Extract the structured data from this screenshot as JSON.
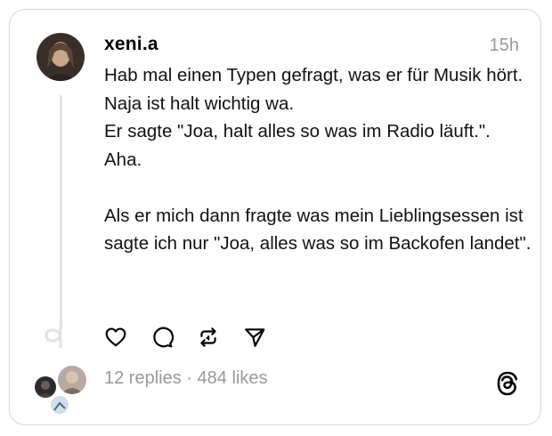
{
  "post": {
    "username": "xeni.a",
    "time": "15h",
    "paragraphs": [
      "Hab mal einen Typen gefragt, was er für Musik hört. Naja ist halt wichtig wa.",
      "Er sagte \"Joa, halt alles so was im Radio läuft.\".",
      "Aha."
    ],
    "paragraph_after_gap": "Als er mich dann fragte was mein Lieblingsessen ist sagte ich nur \"Joa, alles was so im Backofen landet\".",
    "replies": "12 replies",
    "separator": "·",
    "likes": "484 likes"
  },
  "icons": {
    "like": "heart-icon",
    "reply": "comment-icon",
    "repost": "repost-icon",
    "share": "send-icon",
    "brand": "threads-logo-icon"
  },
  "colors": {
    "text": "#000000",
    "muted": "#999999",
    "border": "#d9d9d9",
    "thread_line": "#e3e3e3"
  }
}
